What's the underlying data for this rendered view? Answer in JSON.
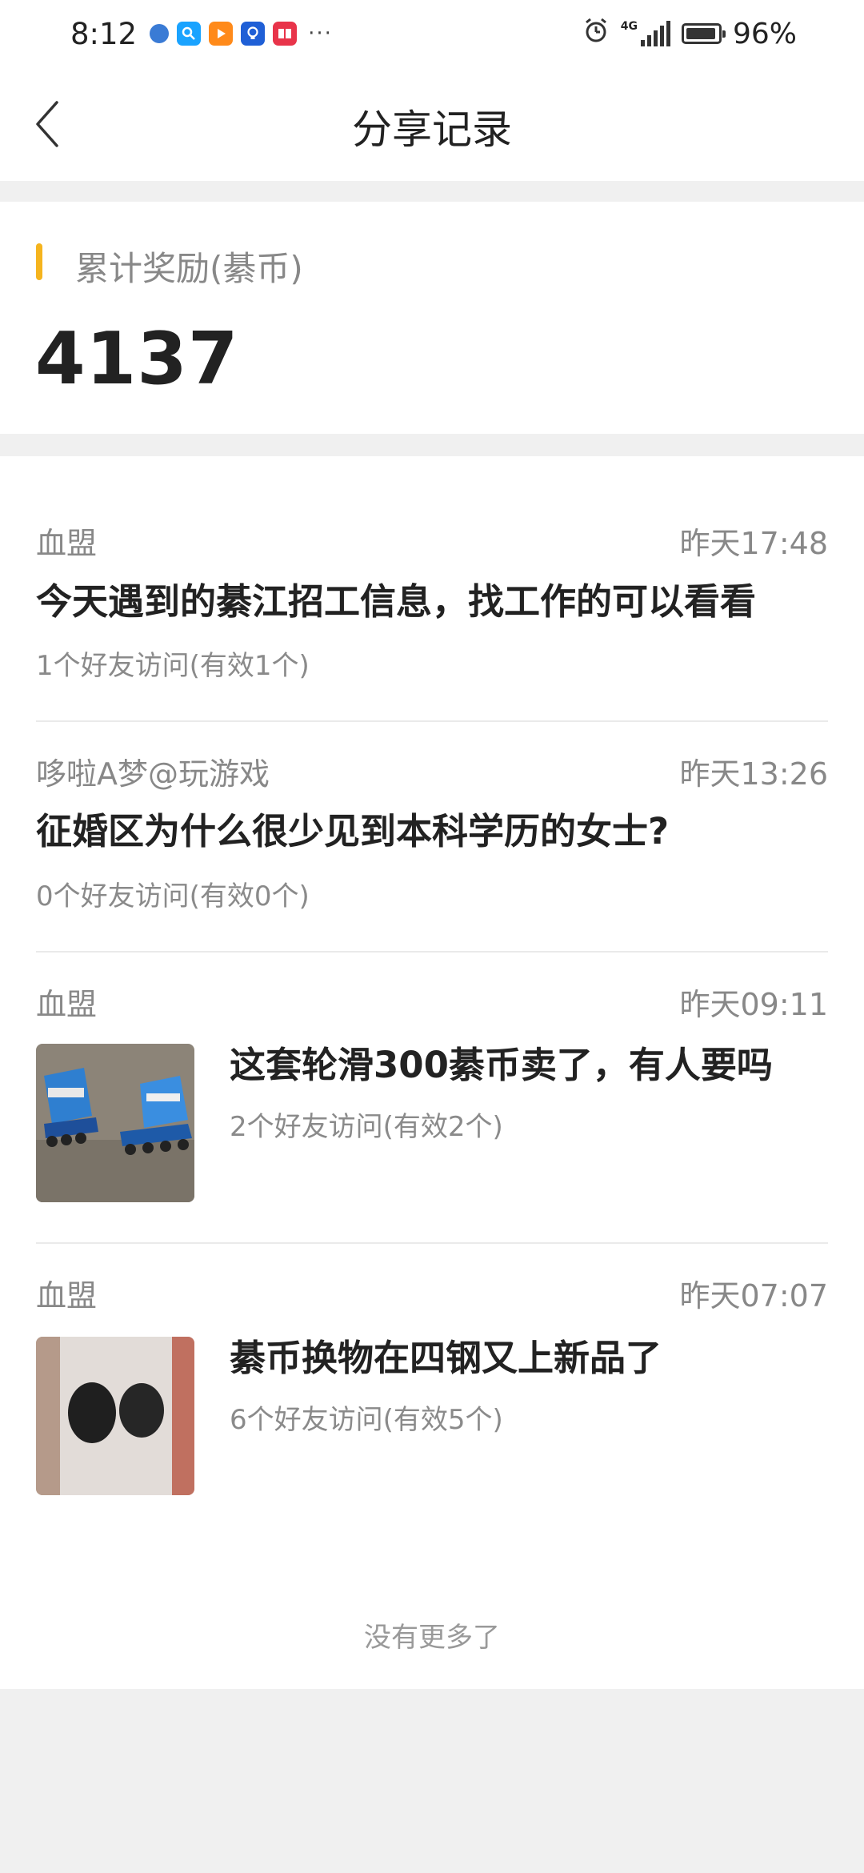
{
  "status_bar": {
    "time": "8:12",
    "app_icons": [
      "browser-icon",
      "search-icon",
      "video-icon",
      "bulb-icon",
      "book-icon"
    ],
    "more": "···",
    "network": "4G",
    "battery": "96%",
    "battery_level": 0.96
  },
  "nav": {
    "title": "分享记录",
    "back_icon": "chevron-left-icon"
  },
  "summary": {
    "label": "累计奖励(綦币)",
    "value": "4137",
    "accent_color": "#f5b41e"
  },
  "records": [
    {
      "author": "血盟",
      "time": "昨天17:48",
      "title": "今天遇到的綦江招工信息，找工作的可以看看",
      "stat": "1个好友访问(有效1个)"
    },
    {
      "author": "哆啦A梦@玩游戏",
      "time": "昨天13:26",
      "title": "征婚区为什么很少见到本科学历的女士?",
      "stat": "0个好友访问(有效0个)"
    },
    {
      "author": "血盟",
      "time": "昨天09:11",
      "title": "这套轮滑300綦币卖了，有人要吗",
      "stat": "2个好友访问(有效2个)"
    },
    {
      "author": "血盟",
      "time": "昨天07:07",
      "title": "綦币换物在四钢又上新品了",
      "stat": "6个好友访问(有效5个)"
    }
  ],
  "footer": "没有更多了"
}
